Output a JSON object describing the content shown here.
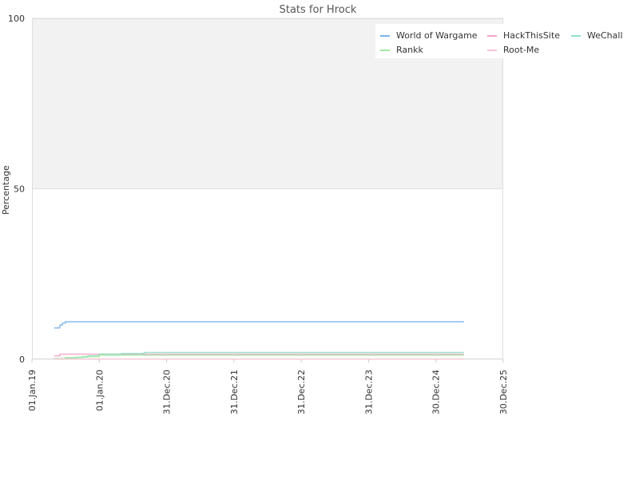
{
  "chart_data": {
    "type": "line",
    "title": "Stats for Hrock",
    "xlabel": "",
    "ylabel": "Percentage",
    "ylim": [
      0,
      100
    ],
    "y_ticks": [
      0,
      50,
      100
    ],
    "x_ticks": [
      "01.Jan.19",
      "01.Jan.20",
      "31.Dec.20",
      "31.Dec.21",
      "31.Dec.22",
      "31.Dec.23",
      "30.Dec.24",
      "30.Dec.25"
    ],
    "x_tick_dates": [
      "2019-01-01",
      "2020-01-01",
      "2020-12-31",
      "2021-12-31",
      "2022-12-31",
      "2023-12-31",
      "2024-12-30",
      "2025-12-30"
    ],
    "xlim": [
      "2019-01-01",
      "2025-12-30"
    ],
    "grid": true,
    "legend_position": "top-right",
    "background_colors": {
      "upper_band": "#f2f2f2",
      "lower_band": "#ffffff"
    },
    "series": [
      {
        "name": "World of Wargame",
        "color": "#7cb5ec",
        "x": [
          "2019-05-01",
          "2019-05-20",
          "2019-06-01",
          "2019-06-15",
          "2019-07-01",
          "2025-05-31"
        ],
        "values": [
          9.2,
          9.2,
          10.0,
          10.6,
          11.0,
          11.0
        ]
      },
      {
        "name": "HackThisSite",
        "color": "#f4a3c4",
        "x": [
          "2019-05-01",
          "2019-06-01",
          "2025-05-31"
        ],
        "values": [
          1.0,
          1.5,
          1.5
        ]
      },
      {
        "name": "WeChall",
        "color": "#90e0c8",
        "x": [
          "2019-05-01",
          "2019-07-01",
          "2019-09-01",
          "2019-11-01",
          "2020-01-01",
          "2020-05-01",
          "2020-09-01",
          "2025-05-31"
        ],
        "values": [
          0.1,
          0.3,
          0.6,
          1.0,
          1.5,
          1.7,
          2.0,
          2.0
        ]
      },
      {
        "name": "Rankk",
        "color": "#a3e8a3",
        "x": [
          "2019-05-01",
          "2019-07-01",
          "2019-10-01",
          "2020-01-01",
          "2025-05-31"
        ],
        "values": [
          0.2,
          0.5,
          0.8,
          1.2,
          1.2
        ]
      },
      {
        "name": "Root-Me",
        "color": "#f7c6d4",
        "x": [
          "2019-05-01",
          "2025-05-31"
        ],
        "values": [
          0.05,
          0.05
        ]
      }
    ]
  }
}
